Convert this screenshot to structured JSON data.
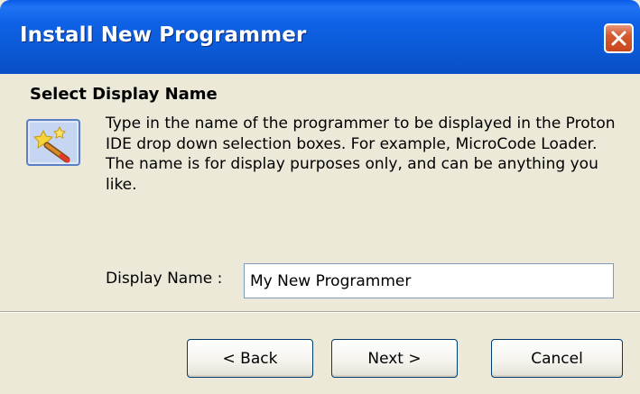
{
  "window": {
    "title": "Install New Programmer",
    "close_icon": "close-icon"
  },
  "header": {
    "title": "Select Display Name"
  },
  "content": {
    "icon": "wizard-wand-icon",
    "description": "Type in the name of the programmer to be displayed in the Proton IDE drop down selection boxes.  For example, MicroCode Loader. The name is for display purposes only, and can be anything you like."
  },
  "form": {
    "display_name_label": "Display Name :",
    "display_name_value": "My New Programmer"
  },
  "buttons": {
    "back": "< Back",
    "next": "Next >",
    "cancel": "Cancel"
  },
  "colors": {
    "titlebar": "#0a5ae8",
    "close_button": "#d5592f",
    "dialog_background": "#ece9d8"
  }
}
